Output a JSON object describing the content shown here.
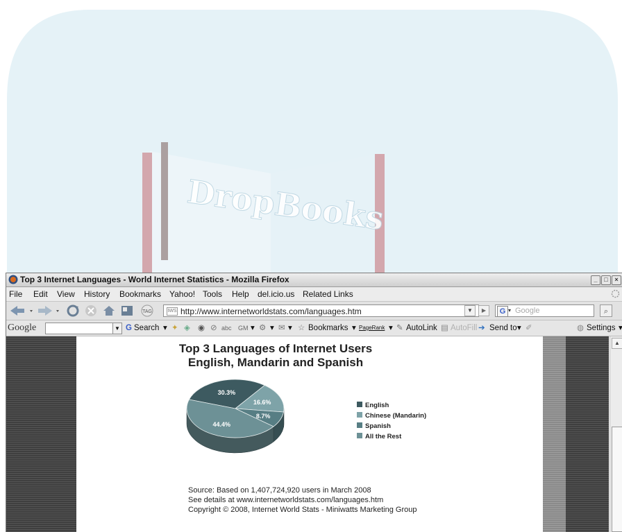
{
  "window": {
    "title": "Top 3 Internet Languages - World Internet Statistics - Mozilla Firefox",
    "controls": [
      "_",
      "□",
      "×"
    ]
  },
  "menu": [
    "File",
    "Edit",
    "View",
    "History",
    "Bookmarks",
    "Yahoo!",
    "Tools",
    "Help",
    "del.icio.us",
    "Related Links"
  ],
  "nav": {
    "url": "http://www.internetworldstats.com/languages.htm",
    "search_placeholder": "Google",
    "tag_label": "TAG",
    "site_icon_text": "IWS"
  },
  "google_bar": {
    "logo": "Google",
    "search_label": "Search",
    "bookmarks_label": "Bookmarks",
    "pagerank_label": "PageRank",
    "autolink_label": "AutoLink",
    "autofill_label": "AutoFill",
    "sendto_label": "Send to",
    "settings_label": "Settings"
  },
  "watermark": {
    "text": "DropBooks"
  },
  "page": {
    "title_line1": "Top 3 Languages of Internet Users",
    "title_line2": "English, Mandarin and Spanish",
    "source_lines": [
      "Source: Based on 1,407,724,920 users in March 2008",
      "See details at www.internetworldstats.com/languages.htm",
      "Copyright © 2008, Internet World Stats - Miniwatts Marketing Group"
    ]
  },
  "chart_data": {
    "type": "pie",
    "title": "Top 3 Languages of Internet Users",
    "subtitle": "English, Mandarin and Spanish",
    "categories": [
      "English",
      "Chinese (Mandarin)",
      "Spanish",
      "All the Rest"
    ],
    "values": [
      30.3,
      16.6,
      8.7,
      44.4
    ],
    "labels": [
      "30.3%",
      "16.6%",
      "8.7%",
      "44.4%"
    ],
    "colors": [
      "#3d5a60",
      "#7ea3a8",
      "#577e84",
      "#6d9196"
    ],
    "legend": "right",
    "three_d": true
  }
}
